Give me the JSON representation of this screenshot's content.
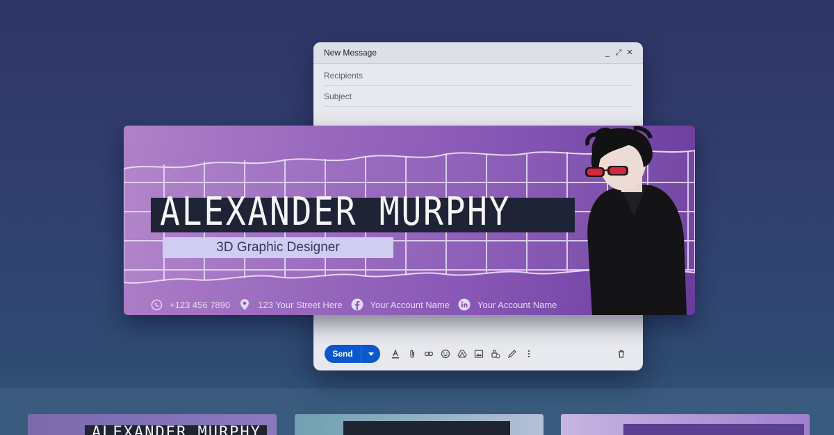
{
  "compose": {
    "title": "New Message",
    "controls": {
      "minimize": "_",
      "expand": "⤢",
      "close": "✕"
    },
    "recipients_placeholder": "Recipients",
    "subject_placeholder": "Subject",
    "send_label": "Send"
  },
  "signature": {
    "name": "ALEXANDER MURPHY",
    "role": "3D Graphic Designer",
    "contacts": [
      {
        "icon": "whatsapp-icon",
        "text": "+123 456 7890"
      },
      {
        "icon": "location-pin-icon",
        "text": "123 Your Street Here"
      },
      {
        "icon": "facebook-icon",
        "text": "Your Account Name"
      },
      {
        "icon": "linkedin-icon",
        "text": "Your Account Name"
      }
    ]
  },
  "thumbnails": [
    {
      "text": "ALEXANDER MURPHY"
    },
    {
      "text": ""
    },
    {
      "text": ""
    }
  ],
  "colors": {
    "send_button": "#0b57d0",
    "banner_purple": "#8655b4",
    "name_strip": "#1e2436",
    "role_strip": "#cfcdf0"
  }
}
